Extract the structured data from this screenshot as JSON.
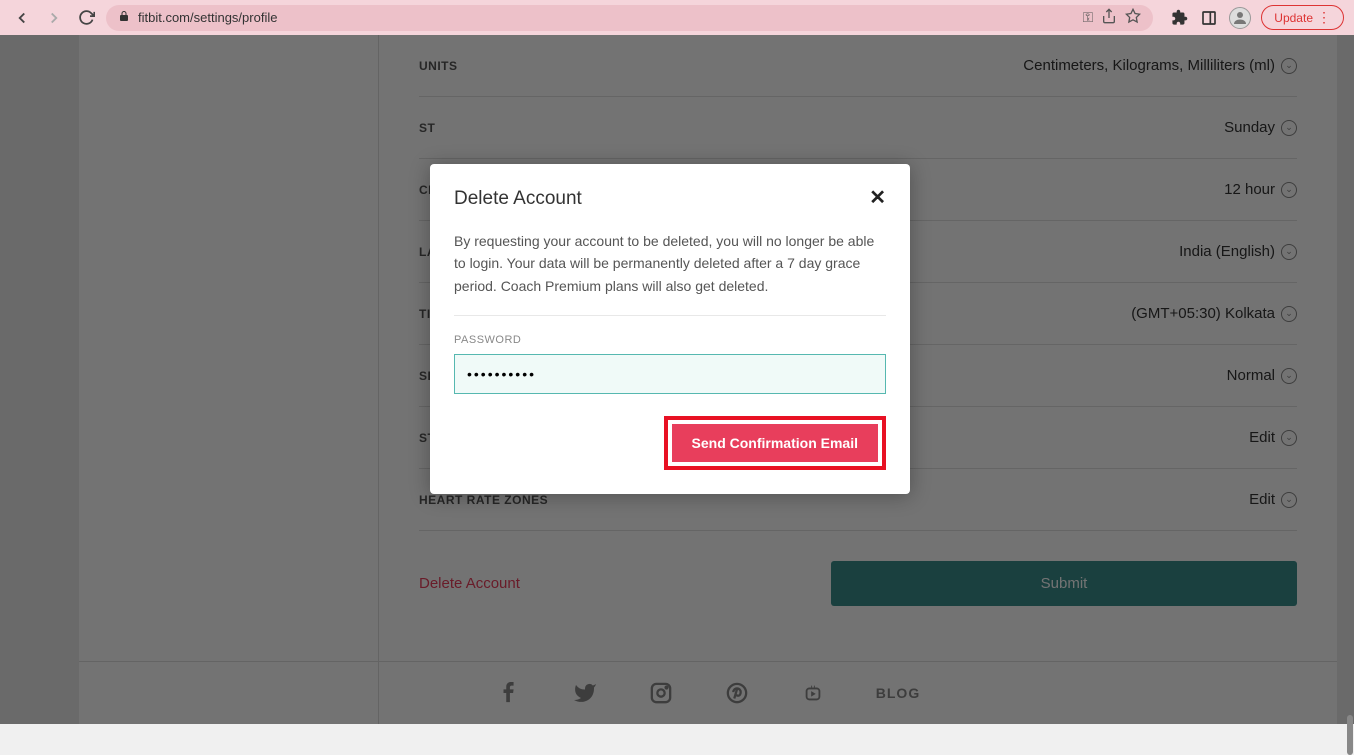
{
  "browser": {
    "url": "fitbit.com/settings/profile",
    "update_label": "Update"
  },
  "settings": [
    {
      "label": "UNITS",
      "value": "Centimeters, Kilograms, Milliliters (ml)"
    },
    {
      "label": "ST",
      "value": "Sunday"
    },
    {
      "label": "CI",
      "value": "12 hour"
    },
    {
      "label": "LA",
      "value": "India (English)"
    },
    {
      "label": "TI",
      "value": "(GMT+05:30) Kolkata"
    },
    {
      "label": "SI",
      "value": "Normal"
    },
    {
      "label": "STRIDE LENGTH",
      "value": "Edit"
    },
    {
      "label": "HEART RATE ZONES",
      "value": "Edit"
    }
  ],
  "actions": {
    "delete_link": "Delete Account",
    "submit_label": "Submit"
  },
  "footer": {
    "blog_label": "BLOG"
  },
  "modal": {
    "title": "Delete Account",
    "body": "By requesting your account to be deleted, you will no longer be able to login. Your data will be permanently deleted after a 7 day grace period. Coach Premium plans will also get deleted.",
    "password_label": "PASSWORD",
    "password_value": "••••••••••",
    "confirm_label": "Send Confirmation Email"
  }
}
